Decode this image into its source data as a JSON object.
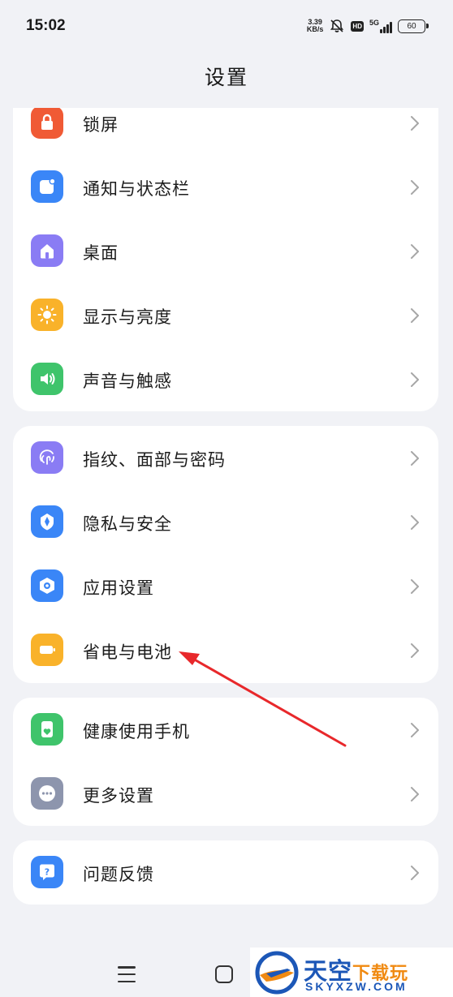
{
  "status_bar": {
    "time": "15:02",
    "net_speed_value": "3.39",
    "net_speed_unit": "KB/s",
    "hd_label": "HD",
    "network_label": "5G",
    "battery_level": "60"
  },
  "header": {
    "title": "设置"
  },
  "groups": [
    {
      "items": [
        {
          "label": "锁屏",
          "icon": "lock-icon",
          "color": "#f05a35"
        },
        {
          "label": "通知与状态栏",
          "icon": "notification-icon",
          "color": "#3a86f7"
        },
        {
          "label": "桌面",
          "icon": "home-icon",
          "color": "#8a7cf4"
        },
        {
          "label": "显示与亮度",
          "icon": "sun-icon",
          "color": "#f9b22a"
        },
        {
          "label": "声音与触感",
          "icon": "speaker-icon",
          "color": "#3fc46b"
        }
      ]
    },
    {
      "items": [
        {
          "label": "指纹、面部与密码",
          "icon": "fingerprint-icon",
          "color": "#8a7cf4"
        },
        {
          "label": "隐私与安全",
          "icon": "shield-icon",
          "color": "#3a86f7"
        },
        {
          "label": "应用设置",
          "icon": "app-settings-icon",
          "color": "#3a86f7"
        },
        {
          "label": "省电与电池",
          "icon": "battery-icon",
          "color": "#f9b22a"
        }
      ]
    },
    {
      "items": [
        {
          "label": "健康使用手机",
          "icon": "health-icon",
          "color": "#3fc46b"
        },
        {
          "label": "更多设置",
          "icon": "more-icon",
          "color": "#8d95ad"
        }
      ]
    },
    {
      "items": [
        {
          "label": "问题反馈",
          "icon": "feedback-icon",
          "color": "#3a86f7"
        }
      ]
    }
  ],
  "watermark": {
    "title_main": "天空",
    "title_accent": "下载玩",
    "subtitle": "SKYXZW.COM"
  },
  "colors": {
    "background": "#f1f2f6",
    "annotation_arrow": "#e8282b",
    "watermark_blue": "#1c57b7",
    "watermark_orange": "#f08a12"
  }
}
